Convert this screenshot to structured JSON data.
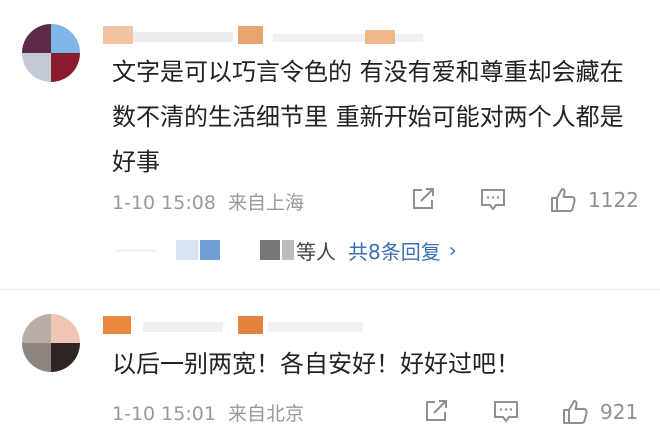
{
  "comments": [
    {
      "text": "文字是可以巧言令色的 有没有爱和尊重却会藏在数不清的生活细节里 重新开始可能对两个人都是好事",
      "time": "1-10 15:08",
      "source": "来自上海",
      "likes": "1122",
      "replies": {
        "suffix": "等人",
        "link": "共8条回复",
        "arrow": "›"
      }
    },
    {
      "text": "以后一别两宽！各自安好！好好过吧！",
      "time": "1-10 15:01",
      "source": "来自北京",
      "likes": "921"
    }
  ],
  "icons": [
    "share-icon",
    "comment-icon",
    "like-icon",
    "chevron-right-icon"
  ],
  "colors": {
    "link": "#3d6fb6",
    "meta": "#9a9a9a",
    "text": "#222222"
  }
}
